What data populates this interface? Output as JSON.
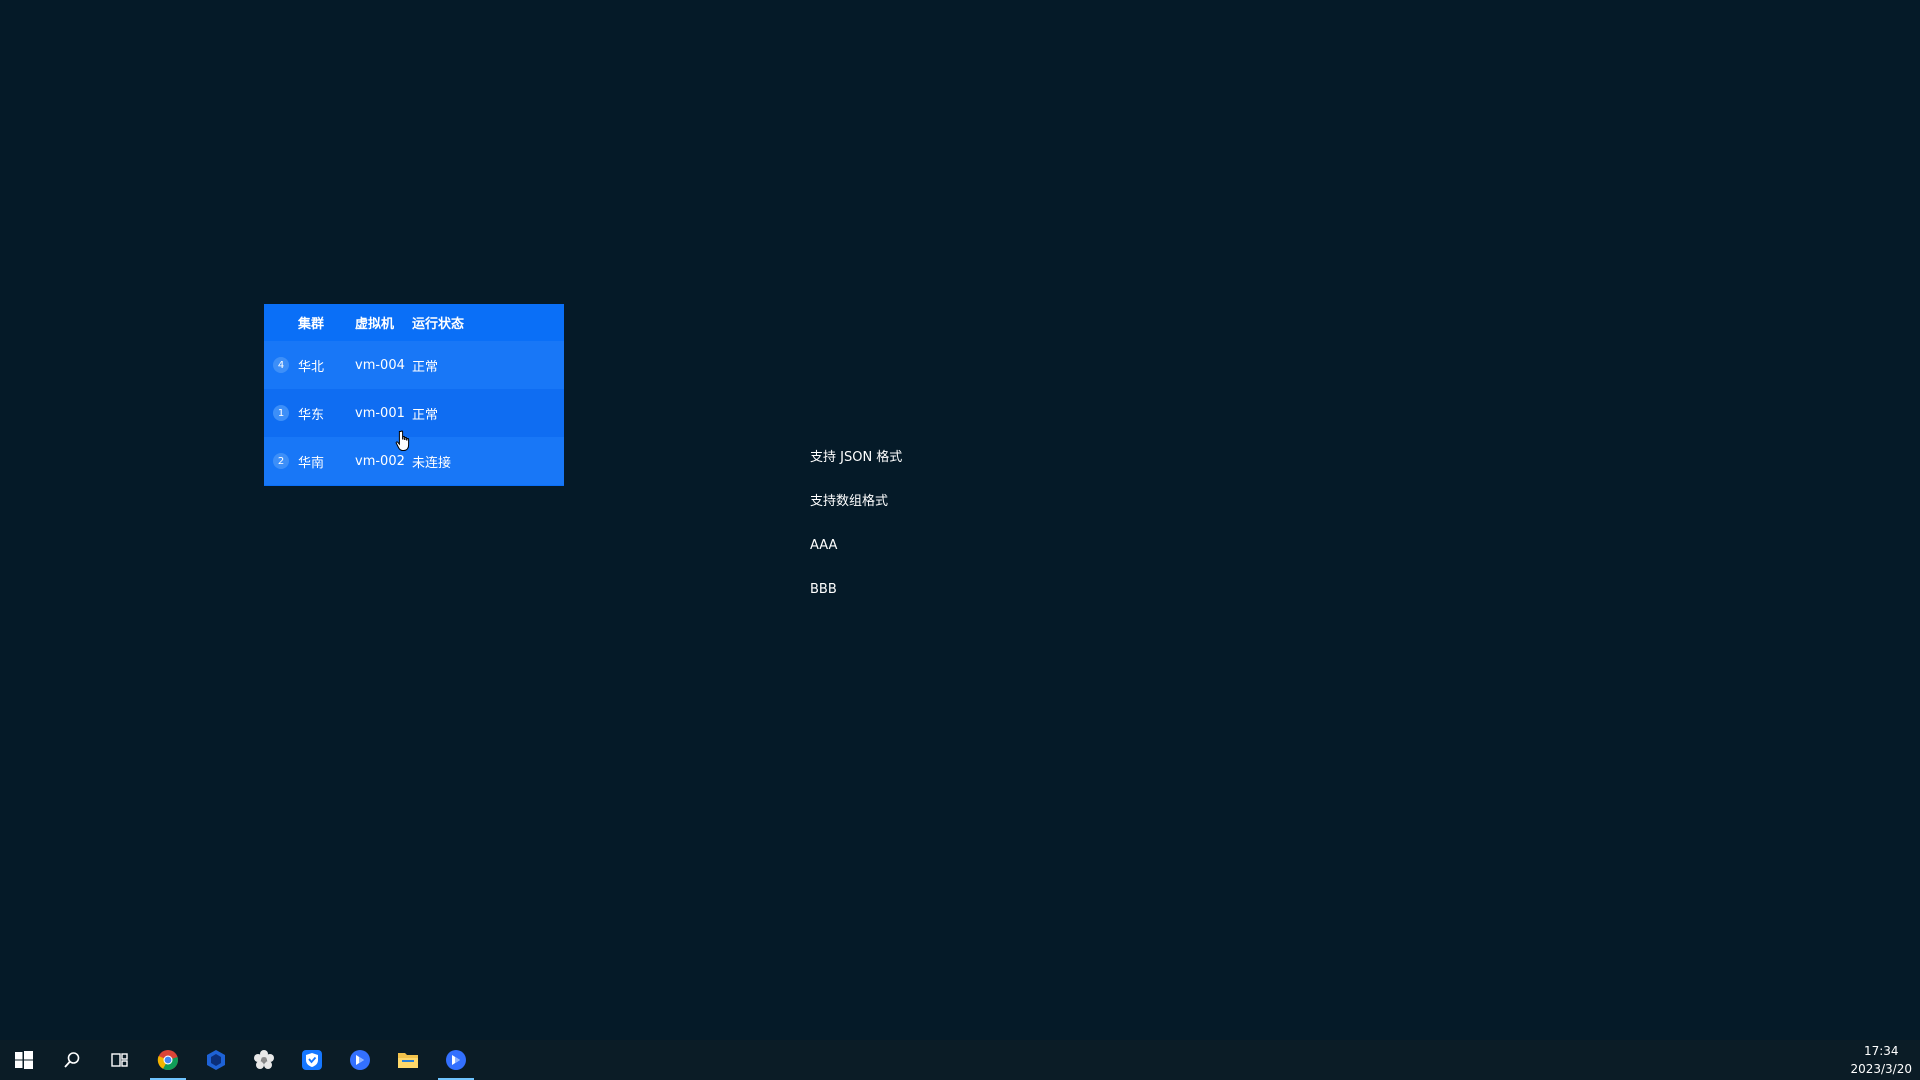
{
  "table": {
    "headers": [
      "集群",
      "虚拟机",
      "运行状态"
    ],
    "rows": [
      {
        "index": "4",
        "cluster": "华北",
        "vm": "vm-004",
        "status": "正常"
      },
      {
        "index": "1",
        "cluster": "华东",
        "vm": "vm-001",
        "status": "正常"
      },
      {
        "index": "2",
        "cluster": "华南",
        "vm": "vm-002",
        "status": "未连接"
      }
    ]
  },
  "scroll_list": {
    "items": [
      "支持 JSON 格式",
      "支持数组格式",
      "AAA",
      "BBB"
    ]
  },
  "taskbar": {
    "icons": [
      "windows-start-icon",
      "search-icon",
      "task-view-icon",
      "chrome-icon",
      "blue-hexagon-app-icon",
      "gear-flower-app-icon",
      "shield-app-icon",
      "feishu-app-icon",
      "file-explorer-icon",
      "feishu-app-icon"
    ],
    "time": "17:34",
    "date": "2023/3/20"
  },
  "colors": {
    "desktop_bg": "#051a28",
    "table_bg": "#0a6ff7",
    "taskbar_bg": "#0b1c26"
  }
}
